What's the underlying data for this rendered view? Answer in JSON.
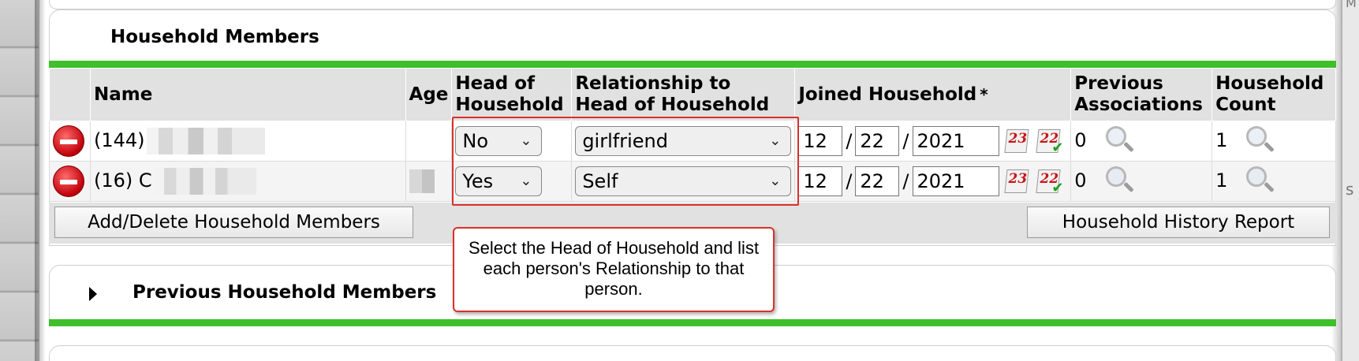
{
  "household_members": {
    "title": "Household Members",
    "columns": {
      "name": "Name",
      "age": "Age",
      "head_of_household": "Head of\nHousehold",
      "relationship": "Relationship to\nHead of Household",
      "joined": "Joined Household",
      "joined_required": "*",
      "previous_associations": "Previous\nAssociations",
      "household_count": "Household\nCount"
    },
    "rows": [
      {
        "name_prefix": "(144)",
        "head_of_household": "No",
        "relationship": "girlfriend",
        "joined_month": "12",
        "joined_day": "22",
        "joined_year": "2021",
        "calendar_number": "23",
        "today_number": "22",
        "previous_associations": "0",
        "household_count": "1"
      },
      {
        "name_prefix": "(16) C",
        "head_of_household": "Yes",
        "relationship": "Self",
        "joined_month": "12",
        "joined_day": "22",
        "joined_year": "2021",
        "calendar_number": "23",
        "today_number": "22",
        "previous_associations": "0",
        "household_count": "1"
      }
    ],
    "add_delete_button": "Add/Delete Household Members",
    "history_report_button": "Household History Report"
  },
  "callout": {
    "text": "Select the Head of Household and list each person's Relationship to that person."
  },
  "previous_household_members": {
    "title": "Previous Household Members"
  },
  "right_edge": {
    "frag1": "M",
    "frag2": "s"
  },
  "colors": {
    "accent_green": "#3fbf2a",
    "highlight_red": "#d9312b",
    "header_gray": "#e1e1e1"
  }
}
